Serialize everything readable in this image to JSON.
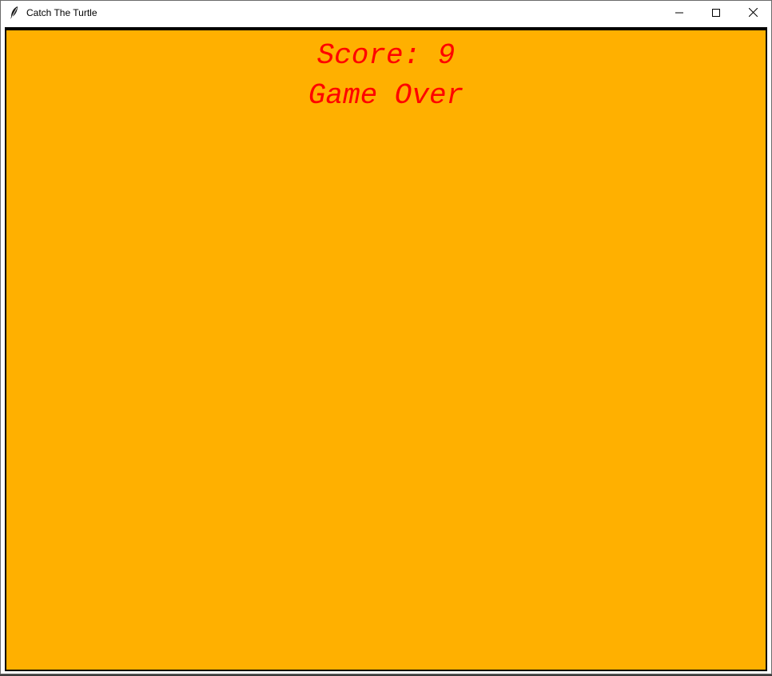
{
  "window": {
    "title": "Catch The Turtle",
    "icon": "feather-icon",
    "controls": {
      "minimize_icon": "minimize-icon",
      "maximize_icon": "maximize-icon",
      "close_icon": "close-icon"
    }
  },
  "canvas": {
    "background_color": "#ffb000",
    "text_color": "#ff0000",
    "score_text": "Score: 9",
    "status_text": "Game Over"
  }
}
